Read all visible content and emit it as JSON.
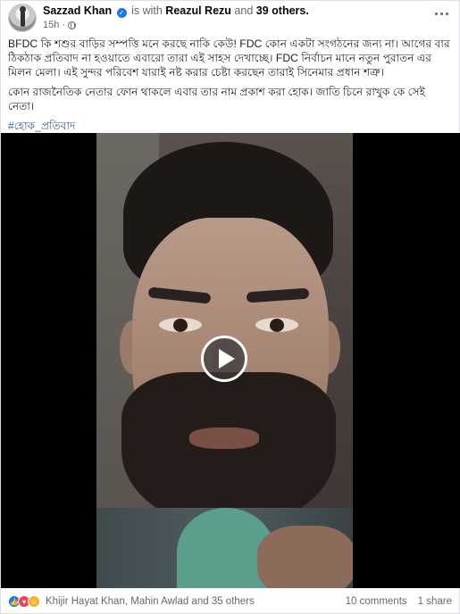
{
  "post": {
    "author": "Sazzad Khan",
    "with_text": "is with",
    "tagged_name": "Reazul Rezu",
    "and_text": "and",
    "others_text": "39 others.",
    "time": "15h",
    "icons": {
      "verified": "verified-badge-icon",
      "audience": "globe-icon",
      "more": "more-options-icon"
    }
  },
  "body": {
    "paragraph_1": "BFDC কি শশুর বাড়ির সম্পত্তি মনে করছে নাকি কেউ! FDC কোন একটা সংগঠনের জন্য না। আগের বার ঠিকঠাক প্রতিবাদ না হওয়াতে এবারো তারা এই সাহস দেখাচ্ছে। FDC নির্বাচন মানে নতুন পুরাতন এর মিলন মেলা। এই সুন্দর পরিবেশ যারাই নষ্ট করার চেষ্টা করছেন তারাই সিনেমার প্রধান শত্রু।",
    "paragraph_2": "কোন রাজনৈতিক নেতার ফোন থাকলে এবার তার নাম প্রকাশ করা হোক। জাতি চিনে রাখুক কে সেই নেতা।",
    "hashtag": "#হোক_প্রতিবাদ"
  },
  "video": {
    "play_icon": "play-icon"
  },
  "footer": {
    "reaction_icons": [
      "like-icon",
      "love-icon",
      "care-icon"
    ],
    "reactors": "Khijir Hayat Khan, Mahin Awlad and 35 others",
    "comments": "10 comments",
    "shares": "1 share"
  },
  "colors": {
    "accent": "#1877f2",
    "link": "#385898",
    "muted": "#65676b"
  }
}
